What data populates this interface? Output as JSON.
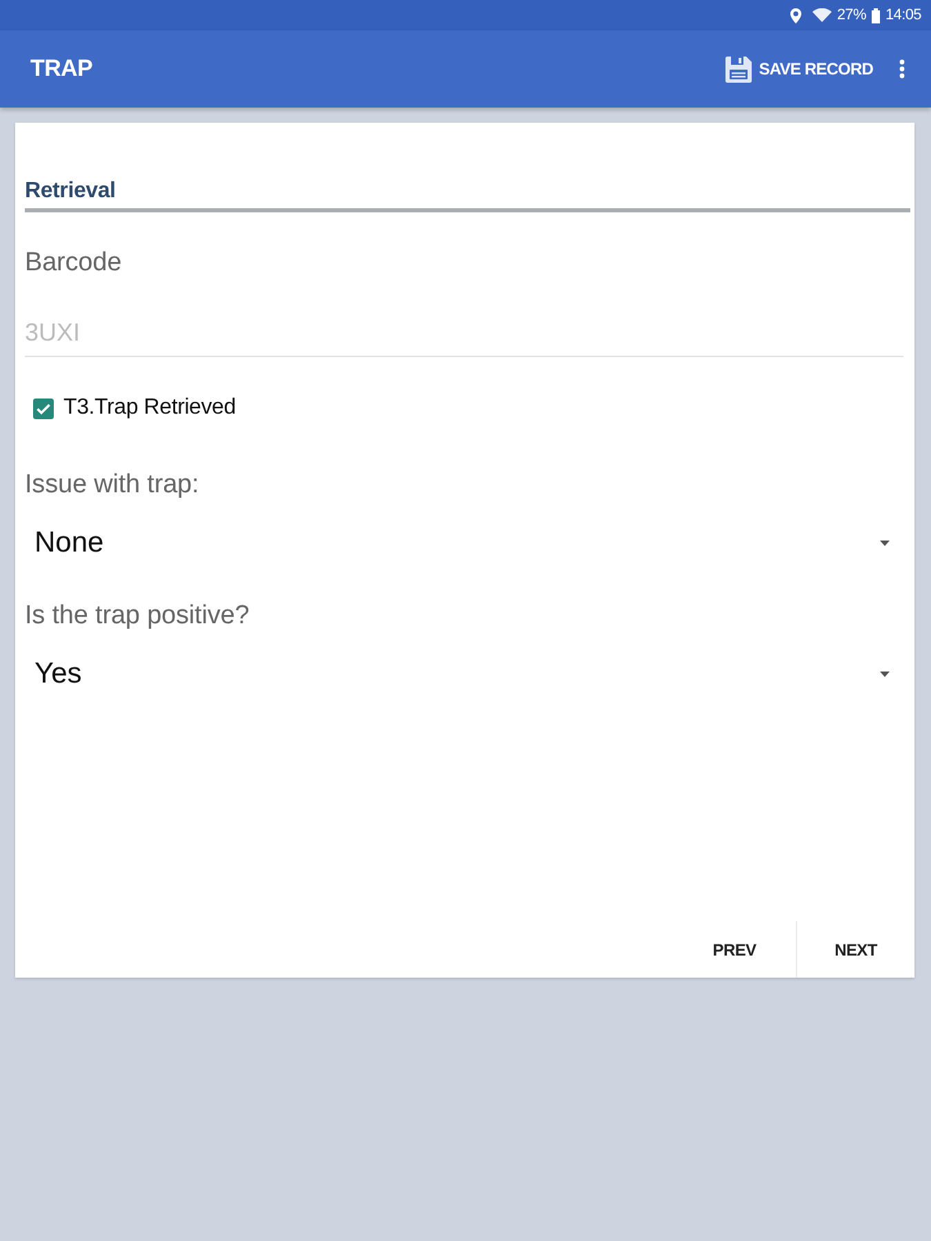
{
  "status_bar": {
    "battery": "27%",
    "time": "14:05"
  },
  "app_bar": {
    "title": "TRAP",
    "actions": [
      {
        "kind": "save",
        "label": "SAVE RECORD"
      },
      {
        "kind": "overflow"
      }
    ]
  },
  "form": {
    "section": "Retrieval",
    "fields": [
      {
        "kind": "text",
        "label": "Barcode",
        "value": "3UXI",
        "disabled": true
      },
      {
        "kind": "checkbox",
        "label": "T3.Trap Retrieved",
        "checked": true
      },
      {
        "kind": "dropdown",
        "label": "Issue with trap:",
        "value": "None"
      },
      {
        "kind": "dropdown",
        "label": "Is the trap positive?",
        "value": "Yes"
      }
    ]
  },
  "nav": {
    "buttons": [
      "PREV",
      "NEXT"
    ]
  }
}
